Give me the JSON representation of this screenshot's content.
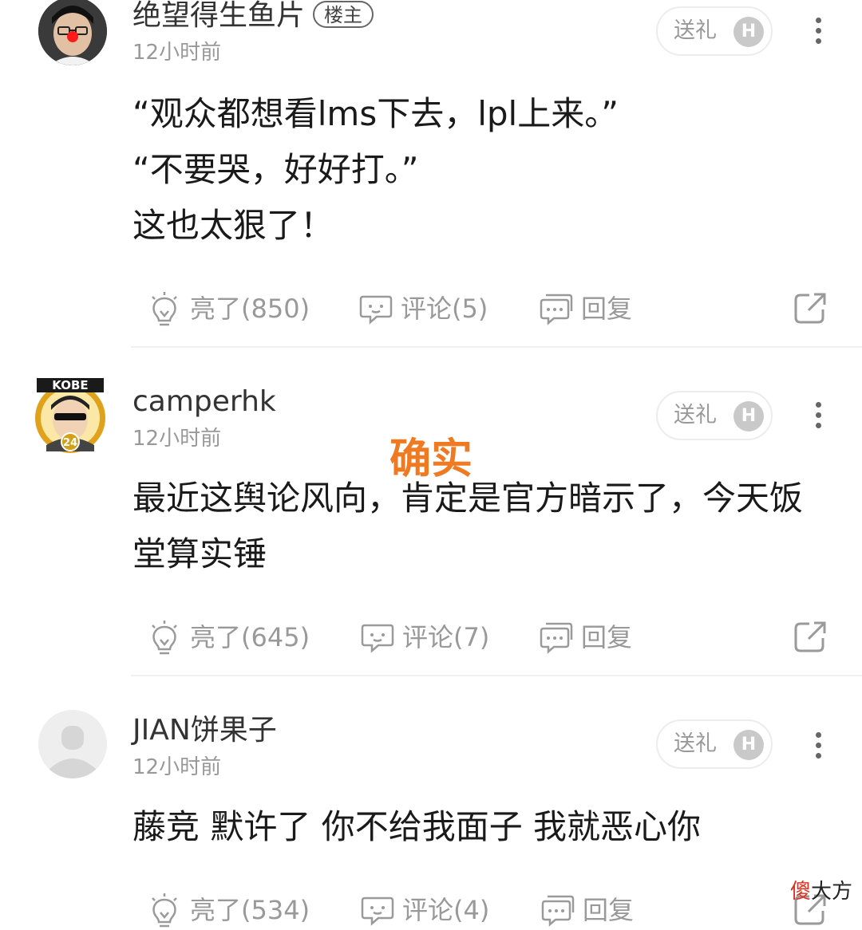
{
  "comments": [
    {
      "username": "绝望得生鱼片",
      "badge": "楼主",
      "time": "12小时前",
      "gift_label": "送礼",
      "coin_letter": "H",
      "lines": [
        "“观众都想看lms下去，lpl上来。”",
        "“不要哭，好好打。”",
        "这也太狠了！"
      ],
      "like_label": "亮了(850)",
      "comment_label": "评论(5)",
      "reply_label": "回复"
    },
    {
      "username": "camperhk",
      "time": "12小时前",
      "gift_label": "送礼",
      "coin_letter": "H",
      "avatar_text": "KOBE",
      "avatar_number": "24",
      "lines": [
        "最近这舆论风向，肯定是官方暗示了，今天饭",
        "堂算实锤"
      ],
      "like_label": "亮了(645)",
      "comment_label": "评论(7)",
      "reply_label": "回复"
    },
    {
      "username": "JIAN饼果子",
      "time": "12小时前",
      "gift_label": "送礼",
      "coin_letter": "H",
      "lines": [
        "藤竞 默许了 你不给我面子 我就恶心你"
      ],
      "like_label": "亮了(534)",
      "comment_label": "评论(4)",
      "reply_label": "回复"
    }
  ],
  "overlay_text": "确实",
  "watermark": {
    "part1": "傻",
    "part2": "大方"
  },
  "colors": {
    "overlay": "#f07a22",
    "meta": "#999999",
    "watermark_red": "#e03020"
  },
  "icons": [
    "lightbulb-icon",
    "comment-bubble-icon",
    "reply-bubble-icon",
    "share-icon",
    "more-icon",
    "coin-icon"
  ]
}
